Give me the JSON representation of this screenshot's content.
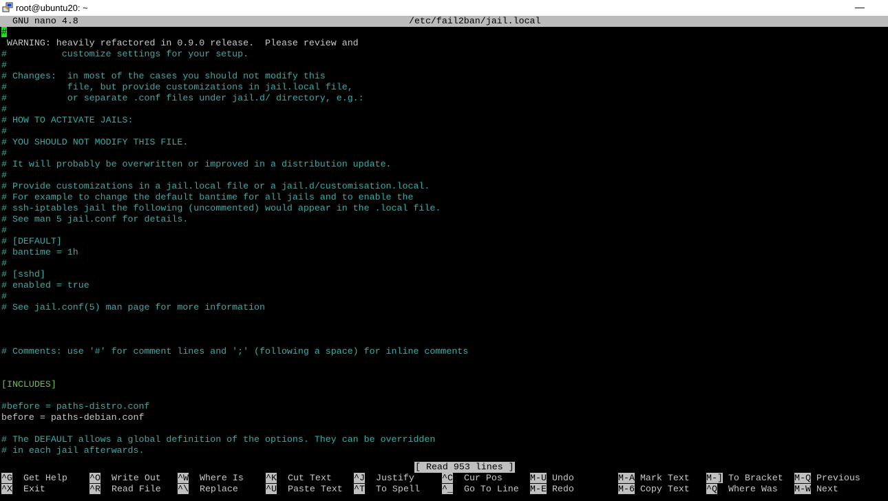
{
  "window": {
    "title": "root@ubuntu20: ~",
    "minimize_label": "—"
  },
  "nano": {
    "version_label": "GNU nano 4.8",
    "filename": "/etc/fail2ban/jail.local"
  },
  "colors": {
    "comment": "#2fb0a8",
    "plain": "#c8c8c8",
    "section": "#6cc04a",
    "cursor": "#1ee31e",
    "header_bg": "#bbbbbb"
  },
  "lines": [
    {
      "text": "#",
      "type": "cursor"
    },
    {
      "text": " WARNING: heavily refactored in 0.9.0 release.  Please review and",
      "type": "plain"
    },
    {
      "text": "#          customize settings for your setup.",
      "type": "comment"
    },
    {
      "text": "#",
      "type": "comment"
    },
    {
      "text": "# Changes:  in most of the cases you should not modify this",
      "type": "comment"
    },
    {
      "text": "#           file, but provide customizations in jail.local file,",
      "type": "comment"
    },
    {
      "text": "#           or separate .conf files under jail.d/ directory, e.g.:",
      "type": "comment"
    },
    {
      "text": "#",
      "type": "comment"
    },
    {
      "text": "# HOW TO ACTIVATE JAILS:",
      "type": "comment"
    },
    {
      "text": "#",
      "type": "comment"
    },
    {
      "text": "# YOU SHOULD NOT MODIFY THIS FILE.",
      "type": "comment"
    },
    {
      "text": "#",
      "type": "comment"
    },
    {
      "text": "# It will probably be overwritten or improved in a distribution update.",
      "type": "comment"
    },
    {
      "text": "#",
      "type": "comment"
    },
    {
      "text": "# Provide customizations in a jail.local file or a jail.d/customisation.local.",
      "type": "comment"
    },
    {
      "text": "# For example to change the default bantime for all jails and to enable the",
      "type": "comment"
    },
    {
      "text": "# ssh-iptables jail the following (uncommented) would appear in the .local file.",
      "type": "comment"
    },
    {
      "text": "# See man 5 jail.conf for details.",
      "type": "comment"
    },
    {
      "text": "#",
      "type": "comment"
    },
    {
      "text": "# [DEFAULT]",
      "type": "comment"
    },
    {
      "text": "# bantime = 1h",
      "type": "comment"
    },
    {
      "text": "#",
      "type": "comment"
    },
    {
      "text": "# [sshd]",
      "type": "comment"
    },
    {
      "text": "# enabled = true",
      "type": "comment"
    },
    {
      "text": "#",
      "type": "comment"
    },
    {
      "text": "# See jail.conf(5) man page for more information",
      "type": "comment"
    },
    {
      "text": "",
      "type": "plain"
    },
    {
      "text": "",
      "type": "plain"
    },
    {
      "text": "",
      "type": "plain"
    },
    {
      "text": "# Comments: use '#' for comment lines and ';' (following a space) for inline comments",
      "type": "comment"
    },
    {
      "text": "",
      "type": "plain"
    },
    {
      "text": "",
      "type": "plain"
    },
    {
      "text": "[INCLUDES]",
      "type": "section"
    },
    {
      "text": "",
      "type": "plain"
    },
    {
      "text": "#before = paths-distro.conf",
      "type": "comment"
    },
    {
      "text": "before = paths-debian.conf",
      "type": "plain"
    },
    {
      "text": "",
      "type": "plain"
    },
    {
      "text": "# The DEFAULT allows a global definition of the options. They can be overridden",
      "type": "comment"
    },
    {
      "text": "# in each jail afterwards.",
      "type": "comment"
    }
  ],
  "status": "[ Read 953 lines ]",
  "shortcuts": [
    [
      {
        "key": "^G",
        "label": "Get Help"
      },
      {
        "key": "^O",
        "label": "Write Out"
      },
      {
        "key": "^W",
        "label": "Where Is"
      },
      {
        "key": "^K",
        "label": "Cut Text"
      },
      {
        "key": "^J",
        "label": "Justify"
      },
      {
        "key": "^C",
        "label": "Cur Pos"
      },
      {
        "key": "M-U",
        "label": "Undo"
      },
      {
        "key": "M-A",
        "label": "Mark Text"
      },
      {
        "key": "M-]",
        "label": "To Bracket"
      },
      {
        "key": "M-Q",
        "label": "Previous"
      }
    ],
    [
      {
        "key": "^X",
        "label": "Exit"
      },
      {
        "key": "^R",
        "label": "Read File"
      },
      {
        "key": "^\\",
        "label": "Replace"
      },
      {
        "key": "^U",
        "label": "Paste Text"
      },
      {
        "key": "^T",
        "label": "To Spell"
      },
      {
        "key": "^_",
        "label": "Go To Line"
      },
      {
        "key": "M-E",
        "label": "Redo"
      },
      {
        "key": "M-6",
        "label": "Copy Text"
      },
      {
        "key": "^Q",
        "label": "Where Was"
      },
      {
        "key": "M-W",
        "label": "Next"
      }
    ]
  ]
}
